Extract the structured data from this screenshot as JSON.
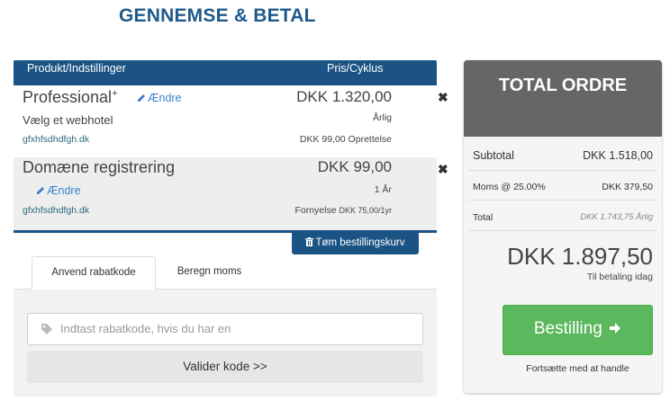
{
  "page": {
    "title": "GENNEMSE & BETAL"
  },
  "cart": {
    "header": {
      "product": "Produkt/Indstillinger",
      "price": "Pris/Cyklus"
    },
    "items": [
      {
        "name": "Professional",
        "name_mark": "+",
        "edit": "Ændre",
        "sub": "Vælg et webhotel",
        "domain": "gfxhfsdhdfgh.dk",
        "price": "DKK 1.320,00",
        "cycle": "Årlig",
        "extra": "DKK 99,00 Oprettelse",
        "remove": "✖"
      },
      {
        "name": "Domæne registrering",
        "edit": "Ændre",
        "domain": "gfxhfsdhdfgh.dk",
        "price": "DKK 99,00",
        "cycle": "1 År",
        "extra": "Fornyelse",
        "extra_small": "DKK 75,00/1yr",
        "remove": "✖"
      }
    ],
    "empty_cart": "Tøm bestillingskurv"
  },
  "tabs": [
    {
      "label": "Anvend rabatkode",
      "active": true
    },
    {
      "label": "Beregn moms",
      "active": false
    }
  ],
  "promo": {
    "placeholder": "Indtast rabatkode, hvis du har en",
    "validate": "Valider kode >>"
  },
  "summary": {
    "title": "TOTAL ORDRE",
    "subtotal_label": "Subtotal",
    "subtotal_value": "DKK 1.518,00",
    "tax_label": "Moms @ 25.00%",
    "tax_value": "DKK 379,50",
    "total_label": "Total",
    "total_value": "DKK 1.743,75 Årlig",
    "total_amount": "DKK 1.897,50",
    "total_note": "Til betaling idag",
    "checkout": "Bestilling",
    "continue": "Fortsætte med at handle"
  },
  "colors": {
    "brand_blue": "#1b5384",
    "title_blue": "#1f5a8c",
    "link_blue": "#3a80c8",
    "summary_head": "#666666",
    "checkout_green": "#5cb85c"
  },
  "icons": [
    "pencil-icon",
    "close-icon",
    "trash-icon",
    "tag-icon",
    "arrow-right-icon"
  ]
}
